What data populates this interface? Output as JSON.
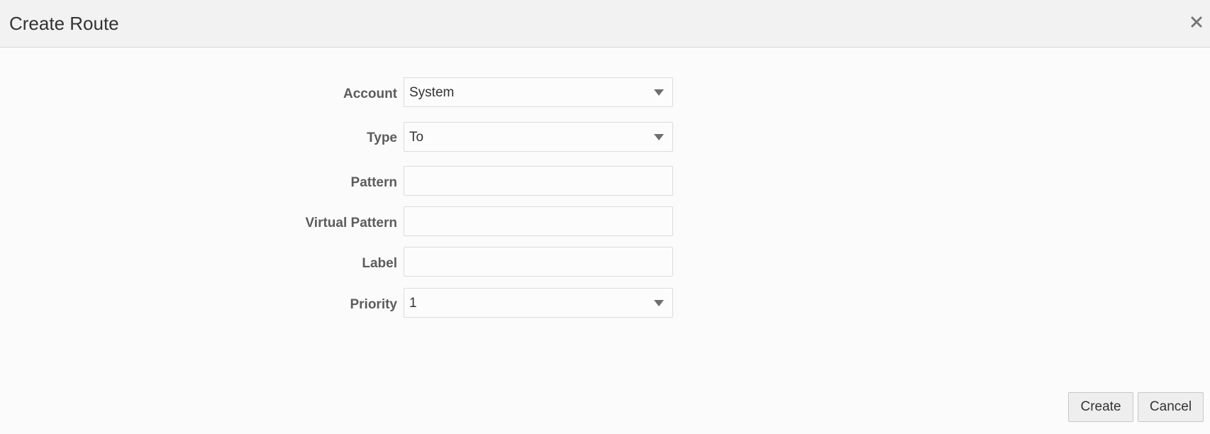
{
  "dialog": {
    "title": "Create Route",
    "close_label": "×"
  },
  "form": {
    "account": {
      "label": "Account",
      "value": "System"
    },
    "type": {
      "label": "Type",
      "value": "To"
    },
    "pattern": {
      "label": "Pattern",
      "value": ""
    },
    "virtual_pattern": {
      "label": "Virtual Pattern",
      "value": ""
    },
    "route_label": {
      "label": "Label",
      "value": ""
    },
    "priority": {
      "label": "Priority",
      "value": "1"
    }
  },
  "actions": {
    "create_label": "Create",
    "cancel_label": "Cancel"
  },
  "icons": {
    "close": "close-icon",
    "dropdown": "chevron-down-icon"
  }
}
